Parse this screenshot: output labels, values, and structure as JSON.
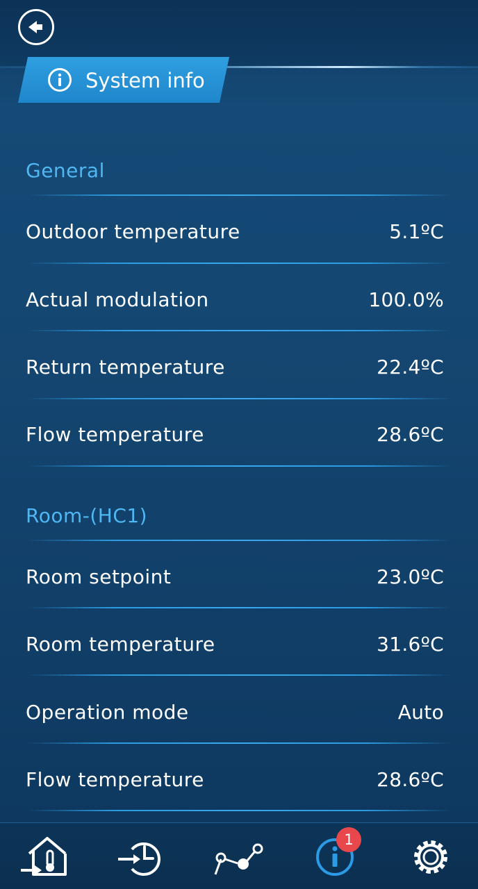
{
  "header": {
    "title": "System info",
    "back_icon": "back-arrow-icon",
    "title_icon": "info-icon"
  },
  "sections": [
    {
      "title": "General",
      "rows": [
        {
          "label": "Outdoor temperature",
          "value": "5.1ºC"
        },
        {
          "label": "Actual modulation",
          "value": "100.0%"
        },
        {
          "label": "Return temperature",
          "value": "22.4ºC"
        },
        {
          "label": "Flow temperature",
          "value": "28.6ºC"
        }
      ]
    },
    {
      "title": "Room-(HC1)",
      "rows": [
        {
          "label": "Room setpoint",
          "value": "23.0ºC"
        },
        {
          "label": "Room temperature",
          "value": "31.6ºC"
        },
        {
          "label": "Operation mode",
          "value": "Auto"
        },
        {
          "label": "Flow temperature",
          "value": "28.6ºC"
        }
      ]
    }
  ],
  "bottom_nav": {
    "items": [
      {
        "icon": "home-thermometer-icon",
        "active": false
      },
      {
        "icon": "schedule-clock-icon",
        "active": false
      },
      {
        "icon": "graph-icon",
        "active": false
      },
      {
        "icon": "info-icon",
        "active": true,
        "badge": "1"
      },
      {
        "icon": "settings-gear-icon",
        "active": false
      }
    ]
  },
  "colors": {
    "accent": "#4fb7f2",
    "active_icon": "#2b9be6",
    "badge": "#e8484b",
    "background": "#144671"
  }
}
